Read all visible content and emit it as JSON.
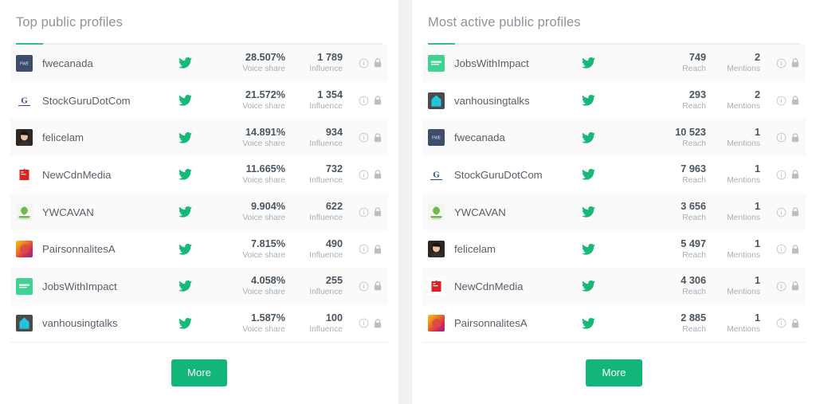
{
  "colors": {
    "accent_green": "#35c08a",
    "button_green": "#11b678",
    "twitter_icon_green": "#16b978",
    "title_gray": "#8d949b",
    "value_gray": "#4a5560",
    "label_gray": "#a9b0b6",
    "row_alt_bg": "#fafafa",
    "panel_bg": "#ffffff",
    "gap_bg": "#f1f1f1"
  },
  "panels": [
    {
      "id": "top-public-profiles",
      "title": "Top public profiles",
      "metric1_label": "Voice share",
      "metric2_label": "Influence",
      "more_label": "More",
      "network_icon": "twitter-icon",
      "info_icon": "info-icon",
      "lock_icon": "lock-icon",
      "rows": [
        {
          "username": "fwecanada",
          "avatar": "fwecanada-avatar",
          "network": "twitter-icon",
          "metric1": "28.507%",
          "metric2": "1 789"
        },
        {
          "username": "StockGuruDotCom",
          "avatar": "stockguru-avatar",
          "network": "twitter-icon",
          "metric1": "21.572%",
          "metric2": "1 354"
        },
        {
          "username": "felicelam",
          "avatar": "felicelam-avatar",
          "network": "twitter-icon",
          "metric1": "14.891%",
          "metric2": "934"
        },
        {
          "username": "NewCdnMedia",
          "avatar": "newcdnmedia-avatar",
          "network": "twitter-icon",
          "metric1": "11.665%",
          "metric2": "732"
        },
        {
          "username": "YWCAVAN",
          "avatar": "ywcavan-avatar",
          "network": "twitter-icon",
          "metric1": "9.904%",
          "metric2": "622"
        },
        {
          "username": "PairsonnalitesA",
          "avatar": "pairsonnalites-avatar",
          "network": "twitter-icon",
          "metric1": "7.815%",
          "metric2": "490"
        },
        {
          "username": "JobsWithImpact",
          "avatar": "jobswithimpact-avatar",
          "network": "twitter-icon",
          "metric1": "4.058%",
          "metric2": "255"
        },
        {
          "username": "vanhousingtalks",
          "avatar": "vanhousingtalks-avatar",
          "network": "twitter-icon",
          "metric1": "1.587%",
          "metric2": "100"
        }
      ]
    },
    {
      "id": "most-active-public-profiles",
      "title": "Most active public profiles",
      "metric1_label": "Reach",
      "metric2_label": "Mentions",
      "more_label": "More",
      "network_icon": "twitter-icon",
      "info_icon": "info-icon",
      "lock_icon": "lock-icon",
      "rows": [
        {
          "username": "JobsWithImpact",
          "avatar": "jobswithimpact-avatar",
          "network": "twitter-icon",
          "metric1": "749",
          "metric2": "2"
        },
        {
          "username": "vanhousingtalks",
          "avatar": "vanhousingtalks-avatar",
          "network": "twitter-icon",
          "metric1": "293",
          "metric2": "2"
        },
        {
          "username": "fwecanada",
          "avatar": "fwecanada-avatar",
          "network": "twitter-icon",
          "metric1": "10 523",
          "metric2": "1"
        },
        {
          "username": "StockGuruDotCom",
          "avatar": "stockguru-avatar",
          "network": "twitter-icon",
          "metric1": "7 963",
          "metric2": "1"
        },
        {
          "username": "YWCAVAN",
          "avatar": "ywcavan-avatar",
          "network": "twitter-icon",
          "metric1": "3 656",
          "metric2": "1"
        },
        {
          "username": "felicelam",
          "avatar": "felicelam-avatar",
          "network": "twitter-icon",
          "metric1": "5 497",
          "metric2": "1"
        },
        {
          "username": "NewCdnMedia",
          "avatar": "newcdnmedia-avatar",
          "network": "twitter-icon",
          "metric1": "4 306",
          "metric2": "1"
        },
        {
          "username": "PairsonnalitesA",
          "avatar": "pairsonnalites-avatar",
          "network": "twitter-icon",
          "metric1": "2 885",
          "metric2": "1"
        }
      ]
    }
  ]
}
